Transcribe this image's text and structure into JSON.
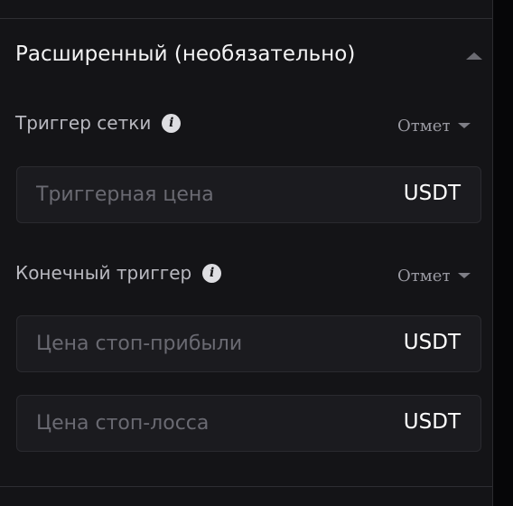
{
  "section": {
    "title": "Расширенный (необязательно)",
    "collapse_icon": "chevron-up-icon"
  },
  "grid_trigger": {
    "label": "Триггер сетки",
    "info_icon": "info-icon",
    "info_glyph": "i",
    "select_value": "Отметка",
    "price_input": {
      "placeholder": "Триггерная цена",
      "value": "",
      "unit": "USDT"
    }
  },
  "end_trigger": {
    "label": "Конечный триггер",
    "info_icon": "info-icon",
    "info_glyph": "i",
    "select_value": "Отметка",
    "take_profit_input": {
      "placeholder": "Цена стоп-прибыли",
      "value": "",
      "unit": "USDT"
    },
    "stop_loss_input": {
      "placeholder": "Цена стоп-лосса",
      "value": "",
      "unit": "USDT"
    }
  },
  "colors": {
    "background": "#060608",
    "panel": "#141417",
    "input_bg": "#1b1b1f",
    "title_text": "#f4f4f5",
    "label_text": "#b9b9c0",
    "placeholder_text": "#6a6a72",
    "unit_text": "#ffffff"
  }
}
